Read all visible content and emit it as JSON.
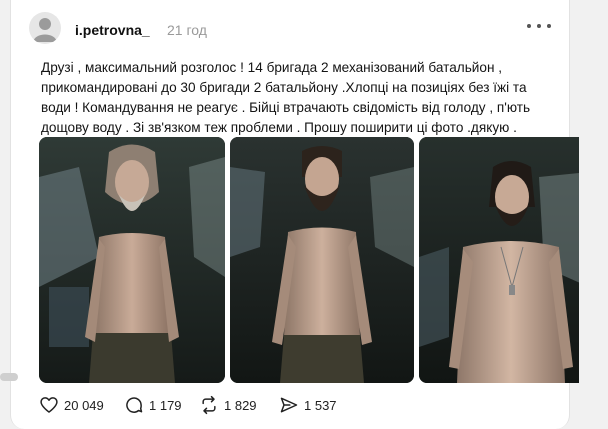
{
  "post": {
    "username": "i.petrovna_",
    "timestamp": "21 год",
    "text_lines": [
      "Друзі , максимальний розголос ! 14 бригада 2 механізований батальйон ,",
      "прикомандировані до 30 бригади 2 батальйону .Хлопці на позиціях без їжі та",
      "води ! Командування не реагує . Бійці втрачають свідомість від голоду , п'ють",
      "дощову воду . Зі зв'язком теж проблеми . Прошу поширити ці фото .дякую ."
    ],
    "photo_count": 3
  },
  "actions": {
    "like_count": "20 049",
    "reply_count": "1 179",
    "repost_count": "1 829",
    "share_count": "1 537"
  },
  "icons": {
    "avatar": "avatar-icon",
    "more": "more-options-icon",
    "like": "heart-icon",
    "reply": "comment-icon",
    "repost": "repost-icon",
    "share": "share-icon"
  },
  "colors": {
    "text": "#141414",
    "muted": "#9a9a9a",
    "background": "#f1f1f1",
    "card": "#ffffff"
  }
}
